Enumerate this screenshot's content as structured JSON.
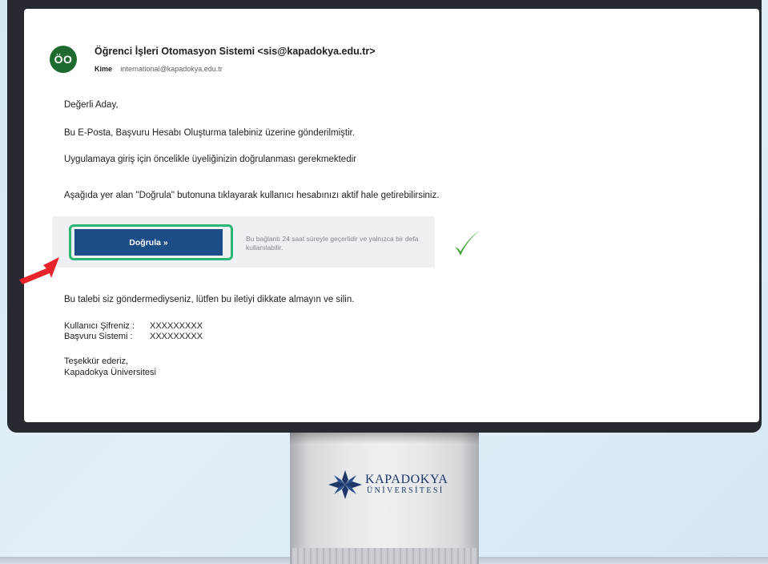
{
  "email": {
    "avatar_initials": "ÖO",
    "sender": "Öğrenci İşleri Otomasyon Sistemi <sis@kapadokya.edu.tr>",
    "to_label": "Kime",
    "to_address": "international@kapadokya.edu.tr",
    "greeting": "Değerli Aday,",
    "para1": "Bu E-Posta, Başvuru Hesabı Oluşturma talebiniz üzerine gönderilmiştir.",
    "para2": "Uygulamaya giriş için öncelikle üyeliğinizin doğrulanması gerekmektedir",
    "para3": "Aşağıda yer alan \"Doğrula\" butonuna tıklayarak kullanıcı hesabınızı aktif hale getirebilirsiniz.",
    "verify_button": "Doğrula »",
    "verify_note": "Bu bağlantı 24 saat süreyle geçerlidir ve yalnızca bir defa kullanılabilir.",
    "para4": "Bu talebi siz göndermediyseniz, lütfen bu iletiyi dikkate almayın ve silin.",
    "cred_password_label": "Kullanıcı Şifreniz :",
    "cred_password_value": "XXXXXXXXX",
    "cred_system_label": "Başvuru Sistemi :",
    "cred_system_value": "XXXXXXXXX",
    "sign_line1": "Teşekkür ederiz,",
    "sign_line2": "Kapadokya Üniversitesi"
  },
  "stand_logo": {
    "name": "KAPADOKYA",
    "subtitle": "ÜNİVERSİTESİ"
  },
  "colors": {
    "button": "#1d4d87",
    "highlight": "#2bb673",
    "avatar": "#1f6b2f",
    "arrow": "#e8232a",
    "logo": "#1f3768"
  }
}
